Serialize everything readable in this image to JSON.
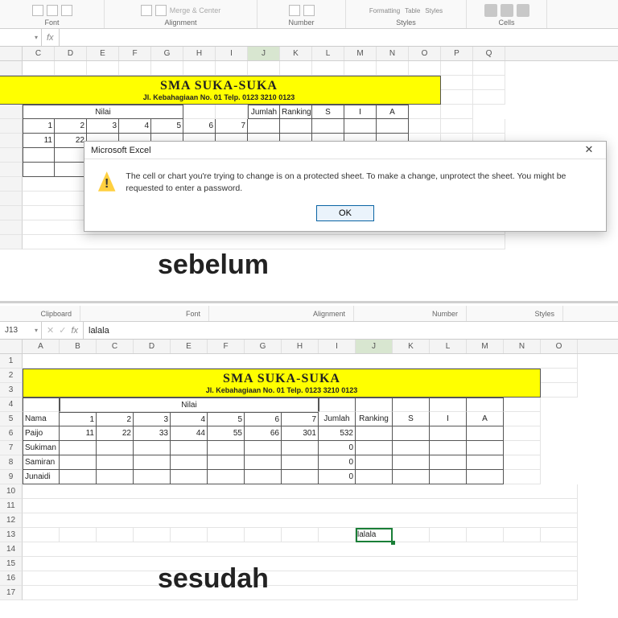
{
  "ribbon_groups_top": [
    "Font",
    "Alignment",
    "Number",
    "Styles",
    "Cells"
  ],
  "ribbon_styles_items": [
    "Formatting",
    "Table",
    "Styles"
  ],
  "ribbon_merge": "Merge & Center",
  "ribbon_groups_bot": [
    "Clipboard",
    "Font",
    "Alignment",
    "Number",
    "Styles"
  ],
  "before": {
    "namebox": "",
    "cols": [
      "C",
      "D",
      "E",
      "F",
      "G",
      "H",
      "I",
      "J",
      "K",
      "L",
      "M",
      "N",
      "O",
      "P",
      "Q"
    ],
    "banner_title": "SMA SUKA-SUKA",
    "banner_sub": "Jl. Kebahagiaan No. 01 Telp. 0123 3210 0123",
    "nilai_label": "Nilai",
    "col_labels": [
      "Jumlah",
      "Ranking",
      "S",
      "I",
      "A"
    ],
    "nilai_nums": [
      "1",
      "2",
      "3",
      "4",
      "5",
      "6",
      "7"
    ],
    "data_row": [
      "11",
      "22"
    ]
  },
  "dialog": {
    "title": "Microsoft Excel",
    "msg": "The cell or chart you're trying to change is on a protected sheet. To make a change, unprotect the sheet. You might be requested to enter a password.",
    "ok": "OK"
  },
  "caption_before": "sebelum",
  "caption_after": "sesudah",
  "after": {
    "namebox": "J13",
    "fx_value": "lalala",
    "cols": [
      "A",
      "B",
      "C",
      "D",
      "E",
      "F",
      "G",
      "H",
      "I",
      "J",
      "K",
      "L",
      "M",
      "N",
      "O"
    ],
    "row_nums": [
      "1",
      "2",
      "3",
      "4",
      "5",
      "6",
      "7",
      "8",
      "9",
      "10",
      "11",
      "12",
      "13",
      "14",
      "15",
      "16",
      "17"
    ],
    "banner_title": "SMA SUKA-SUKA",
    "banner_sub": "Jl. Kebahagiaan No. 01 Telp. 0123 3210 0123",
    "headers": {
      "nama": "Nama",
      "nilai": "Nilai",
      "jumlah": "Jumlah",
      "ranking": "Ranking",
      "s": "S",
      "i": "I",
      "a": "A"
    },
    "nilai_nums": [
      "1",
      "2",
      "3",
      "4",
      "5",
      "6",
      "7"
    ],
    "rows": [
      {
        "nama": "Paijo",
        "n": [
          "11",
          "22",
          "33",
          "44",
          "55",
          "66",
          "301"
        ],
        "jumlah": "532"
      },
      {
        "nama": "Sukiman",
        "n": [
          "",
          "",
          "",
          "",
          "",
          "",
          ""
        ],
        "jumlah": "0"
      },
      {
        "nama": "Samiran",
        "n": [
          "",
          "",
          "",
          "",
          "",
          "",
          ""
        ],
        "jumlah": "0"
      },
      {
        "nama": "Junaidi",
        "n": [
          "",
          "",
          "",
          "",
          "",
          "",
          ""
        ],
        "jumlah": "0"
      }
    ],
    "active_cell_value": "lalala"
  }
}
